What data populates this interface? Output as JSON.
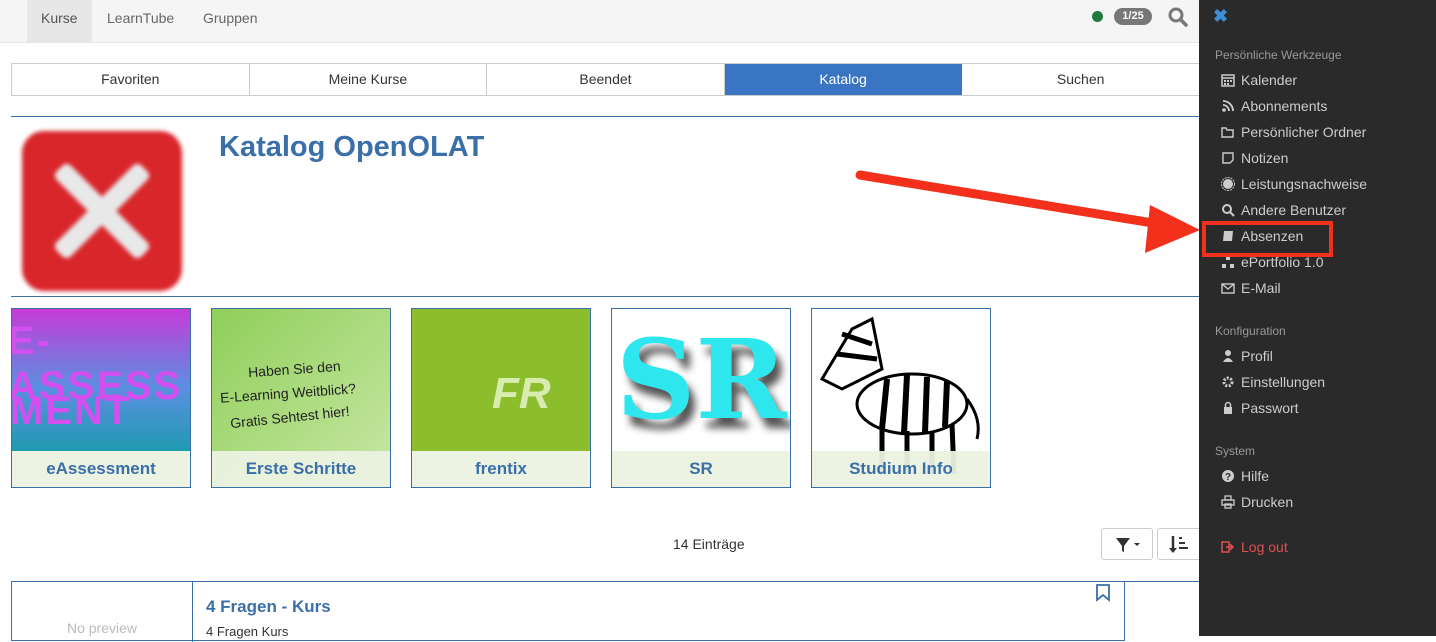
{
  "topnav": {
    "tabs": [
      "Kurse",
      "LearnTube",
      "Gruppen"
    ],
    "badge": "1/25"
  },
  "subtabs": [
    "Favoriten",
    "Meine Kurse",
    "Beendet",
    "Katalog",
    "Suchen"
  ],
  "catalog": {
    "title": "Katalog OpenOLAT",
    "tiles": [
      "eAssessment",
      "Erste Schritte",
      "frentix",
      "SR",
      "Studium Info"
    ],
    "count": "14 Einträge"
  },
  "tile_text": {
    "eassess_line1": "E-ASSESS",
    "eassess_line2": "MENT",
    "erste_line1": "Haben Sie den",
    "erste_line2": "E-Learning Weitblick?",
    "erste_line3": "Gratis Sehtest hier!",
    "frentix_logo": "FR",
    "sr_logo": "SR"
  },
  "entry": {
    "preview": "No preview",
    "title": "4 Fragen - Kurs",
    "subtitle": "4 Fragen Kurs"
  },
  "panel": {
    "section1": "Persönliche Werkzeuge",
    "tools": [
      "Kalender",
      "Abonnements",
      "Persönlicher Ordner",
      "Notizen",
      "Leistungsnachweise",
      "Andere Benutzer",
      "Absenzen",
      "ePortfolio 1.0",
      "E-Mail"
    ],
    "section2": "Konfiguration",
    "config": [
      "Profil",
      "Einstellungen",
      "Passwort"
    ],
    "section3": "System",
    "system": [
      "Hilfe",
      "Drucken"
    ],
    "logout": "Log out"
  },
  "colors": {
    "accent": "#3a75c4",
    "panel_bg": "#2a2a2a",
    "highlight": "#f2301b",
    "logout": "#e05050"
  }
}
